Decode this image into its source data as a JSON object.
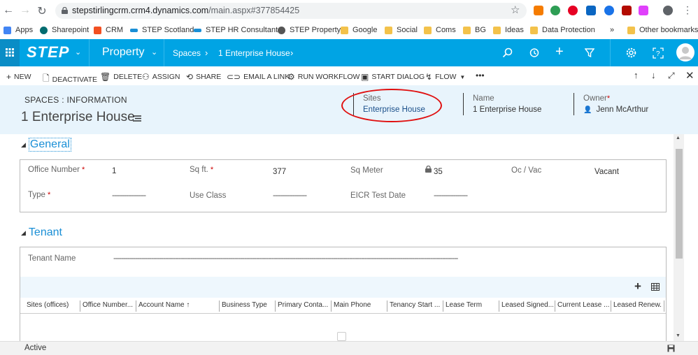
{
  "browser": {
    "url_host": "stepstirlingcrm.crm4.dynamics.com",
    "url_path": "/main.aspx#377854425",
    "bookmarks": [
      {
        "label": "Apps",
        "icon": "apps-grid-icon",
        "color": "#4285f4"
      },
      {
        "label": "Sharepoint",
        "icon": "sharepoint-icon",
        "color": "#036c70"
      },
      {
        "label": "CRM",
        "icon": "microsoft-icon",
        "color": "#f25022"
      },
      {
        "label": "STEP Scotland",
        "icon": "step-icon",
        "color": "#1a8fd6"
      },
      {
        "label": "STEP HR Consultant...",
        "icon": "step-icon",
        "color": "#1a8fd6"
      },
      {
        "label": "STEP Property",
        "icon": "globe-icon",
        "color": "#555555"
      },
      {
        "label": "Google",
        "icon": "folder-icon",
        "color": "#f3c24b"
      },
      {
        "label": "Social",
        "icon": "folder-icon",
        "color": "#f3c24b"
      },
      {
        "label": "Coms",
        "icon": "folder-icon",
        "color": "#f3c24b"
      },
      {
        "label": "BG",
        "icon": "folder-icon",
        "color": "#f3c24b"
      },
      {
        "label": "Ideas",
        "icon": "folder-icon",
        "color": "#f3c24b"
      },
      {
        "label": "Data Protection",
        "icon": "folder-icon",
        "color": "#f3c24b"
      }
    ],
    "more_bookmarks": "»",
    "other_bookmarks": "Other bookmarks"
  },
  "crm": {
    "brand": "STEP",
    "module": "Property",
    "breadcrumb": [
      "Spaces",
      "1 Enterprise House"
    ],
    "accent": "#00a4e4"
  },
  "commands": [
    "NEW",
    "DEACTIVATE",
    "DELETE",
    "ASSIGN",
    "SHARE",
    "EMAIL A LINK",
    "RUN WORKFLOW",
    "START DIALOG",
    "FLOW",
    "•••"
  ],
  "header": {
    "entity": "SPACES : INFORMATION",
    "record": "1 Enterprise House",
    "fields": [
      {
        "label": "Sites",
        "value": "Enterprise House"
      },
      {
        "label": "Name",
        "value": "1 Enterprise House"
      },
      {
        "label": "Owner",
        "value": "Jenn McArthur"
      }
    ]
  },
  "general": {
    "title": "General",
    "office_number": {
      "label": "Office Number",
      "value": "1"
    },
    "sq_ft": {
      "label": "Sq ft.",
      "value": "377"
    },
    "sq_meter": {
      "label": "Sq Meter",
      "value": "35"
    },
    "oc_vac": {
      "label": "Oc / Vac",
      "value": "Vacant"
    },
    "type": {
      "label": "Type",
      "value": "-----------------"
    },
    "use_class": {
      "label": "Use Class",
      "value": "-----------------"
    },
    "eicr": {
      "label": "EICR Test Date",
      "value": "-----------------"
    }
  },
  "tenant": {
    "title": "Tenant",
    "tenant_name": {
      "label": "Tenant Name",
      "value": "------------------------------------------------------------------------------------------------------------------------------------------------------------------------------"
    },
    "columns": [
      "Sites (offices)",
      "Office Number...",
      "Account Name ↑",
      "Business Type",
      "Primary Conta...",
      "Main Phone",
      "Tenancy Start ...",
      "Lease Term",
      "Leased Signed...",
      "Current Lease ...",
      "Leased Renew..."
    ]
  },
  "status": "Active"
}
